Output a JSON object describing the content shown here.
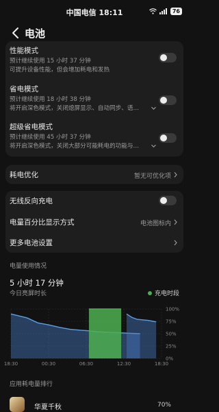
{
  "status_bar": {
    "carrier_time": "中国电信 18:11",
    "battery_level": "76"
  },
  "header": {
    "title": "电池"
  },
  "modes": {
    "performance": {
      "title": "性能模式",
      "estimate": "预计继续使用 15 小时 37 分钟",
      "desc": "可提升设备性能，但会增加耗电和发热",
      "enabled": false
    },
    "power_saving": {
      "title": "省电模式",
      "estimate": "预计继续使用 18 小时 38 分钟",
      "desc": "将开启深色模式，关闭熄屏显示、自动同步、语…",
      "enabled": false
    },
    "super_saving": {
      "title": "超级省电模式",
      "estimate": "预计继续使用 45 小时 37 分钟",
      "desc": "将开启深色模式，关闭大部分可能耗电的功能与…",
      "enabled": false
    }
  },
  "optimization": {
    "title": "耗电优化",
    "value": "暂无可优化项"
  },
  "settings": {
    "wireless_reverse": {
      "title": "无线反向充电",
      "enabled": false
    },
    "percent_display": {
      "title": "电量百分比显示方式",
      "value": "电池图标内"
    },
    "more": {
      "title": "更多电池设置"
    }
  },
  "usage": {
    "section_title": "电量使用情况",
    "screen_on_time": "5 小时 17 分钟",
    "screen_on_label": "今日亮屏时长",
    "legend_charging": "充电时段"
  },
  "chart_data": {
    "type": "area",
    "x_ticks": [
      "18:30",
      "00:30",
      "06:30",
      "12:30",
      "18:30"
    ],
    "y_ticks": [
      "100%",
      "75%",
      "50%",
      "25%",
      "0%"
    ],
    "ylim": [
      0,
      100
    ],
    "series": [
      {
        "x_hours": [
          0,
          1.5,
          3,
          5,
          7,
          9,
          11,
          13,
          14.4,
          16,
          18,
          20,
          22,
          24
        ],
        "values": [
          90,
          86,
          82,
          72,
          68,
          63,
          59,
          57,
          56,
          54,
          53,
          52,
          51,
          50
        ]
      },
      {
        "x_hours": [
          14.5,
          15.5,
          16.5,
          17.5,
          18.5,
          19.5,
          20.5
        ],
        "values": [
          100,
          100,
          100,
          100,
          100,
          100,
          100
        ]
      },
      {
        "x_hours": [
          21.5,
          22.5,
          23.5,
          24.5,
          25.5,
          26.5,
          27.0
        ],
        "values": [
          90,
          83,
          79,
          78,
          77,
          75,
          74
        ]
      }
    ],
    "charging_band_hours": [
      14.5,
      21
    ]
  },
  "ranking": {
    "title": "应用耗电量排行",
    "apps": [
      {
        "name": "华夏千秋",
        "percent": "70%"
      }
    ]
  },
  "colors": {
    "background": "#121212",
    "card": "#1e1e1e",
    "usage_line": "#5aa0e8",
    "charging": "#4caf50"
  }
}
